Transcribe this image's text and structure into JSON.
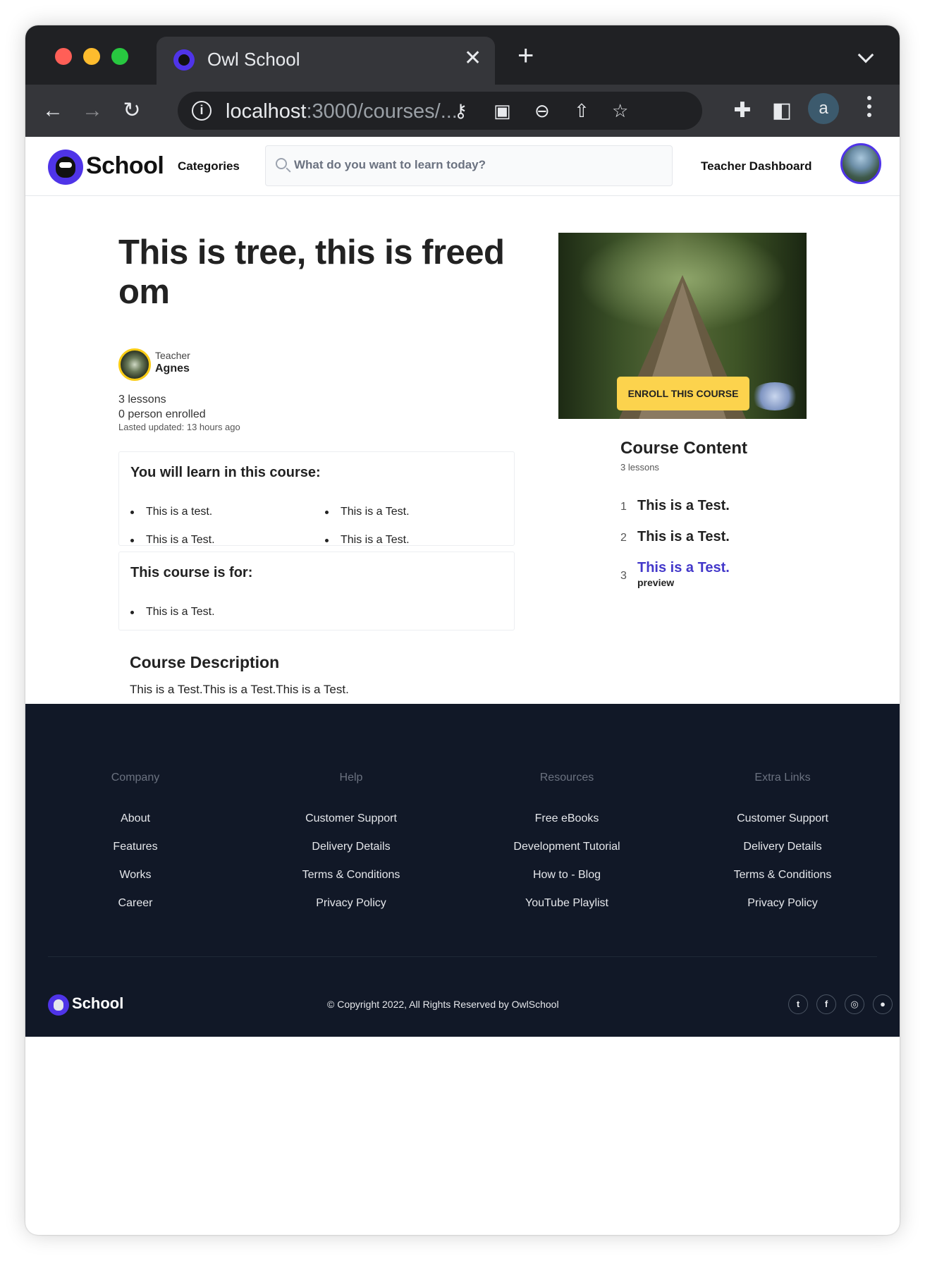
{
  "browser": {
    "tab_title": "Owl School",
    "tab_close": "✕",
    "new_tab": "+",
    "url_host": "localhost",
    "url_path": ":3000/courses/...",
    "profile_initial": "a"
  },
  "header": {
    "logo_text": "School",
    "categories": "Categories",
    "search_placeholder": "What do you want to learn today?",
    "teacher_dashboard": "Teacher Dashboard"
  },
  "course": {
    "title": "This is tree, this is freedom",
    "teacher_label": "Teacher",
    "teacher_name": "Agnes",
    "lessons_count": "3 lessons",
    "enrolled": "0 person enrolled",
    "last_updated": "Lasted updated: 13 hours ago",
    "learn_title": "You will learn in this course:",
    "learn_items": [
      "This is a test.",
      "This is a Test.",
      "This is a Test.",
      "This is a Test."
    ],
    "for_title": "This course is for:",
    "for_items": [
      "This is a Test."
    ],
    "description_title": "Course Description",
    "description": "This is a Test.This is a Test.This is a Test.",
    "enroll_label": "ENROLL THIS COURSE"
  },
  "content": {
    "title": "Course Content",
    "count": "3 lessons",
    "lessons": [
      {
        "num": "1",
        "title": "This is a Test."
      },
      {
        "num": "2",
        "title": "This is a Test."
      },
      {
        "num": "3",
        "title": "This is a Test.",
        "tag": "preview"
      }
    ]
  },
  "footer": {
    "columns": [
      {
        "heading": "Company",
        "links": [
          "About",
          "Features",
          "Works",
          "Career"
        ]
      },
      {
        "heading": "Help",
        "links": [
          "Customer Support",
          "Delivery Details",
          "Terms & Conditions",
          "Privacy Policy"
        ]
      },
      {
        "heading": "Resources",
        "links": [
          "Free eBooks",
          "Development Tutorial",
          "How to - Blog",
          "YouTube Playlist"
        ]
      },
      {
        "heading": "Extra Links",
        "links": [
          "Customer Support",
          "Delivery Details",
          "Terms & Conditions",
          "Privacy Policy"
        ]
      }
    ],
    "logo_text": "School",
    "copyright": "© Copyright 2022, All Rights Reserved by OwlSchool",
    "social_icons": [
      "twitter-icon",
      "facebook-icon",
      "instagram-icon",
      "github-icon"
    ]
  },
  "colors": {
    "brand": "#4f34e8",
    "accent": "#fcd34d",
    "link": "#4338ca",
    "footer_bg": "#111827"
  }
}
